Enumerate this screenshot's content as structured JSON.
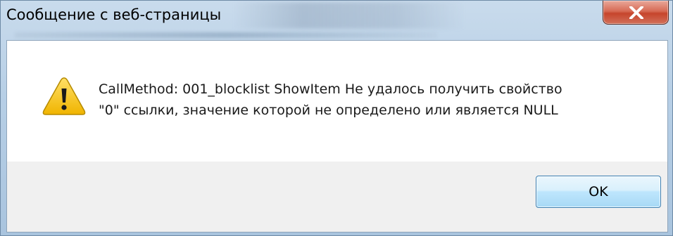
{
  "window": {
    "title": "Сообщение с веб-страницы",
    "close_icon": "close-icon"
  },
  "dialog": {
    "icon": "warning-icon",
    "message_line1": "CallMethod: 001_blocklist ShowItem Не удалось получить свойство",
    "message_line2": "\"0\" ссылки, значение которой не определено или является NULL",
    "ok_label": "OK"
  },
  "colors": {
    "frame": "#b7cfe6",
    "close_button": "#c6452c",
    "warning_fill": "#f5c400",
    "ok_border": "#3c7fb1"
  }
}
